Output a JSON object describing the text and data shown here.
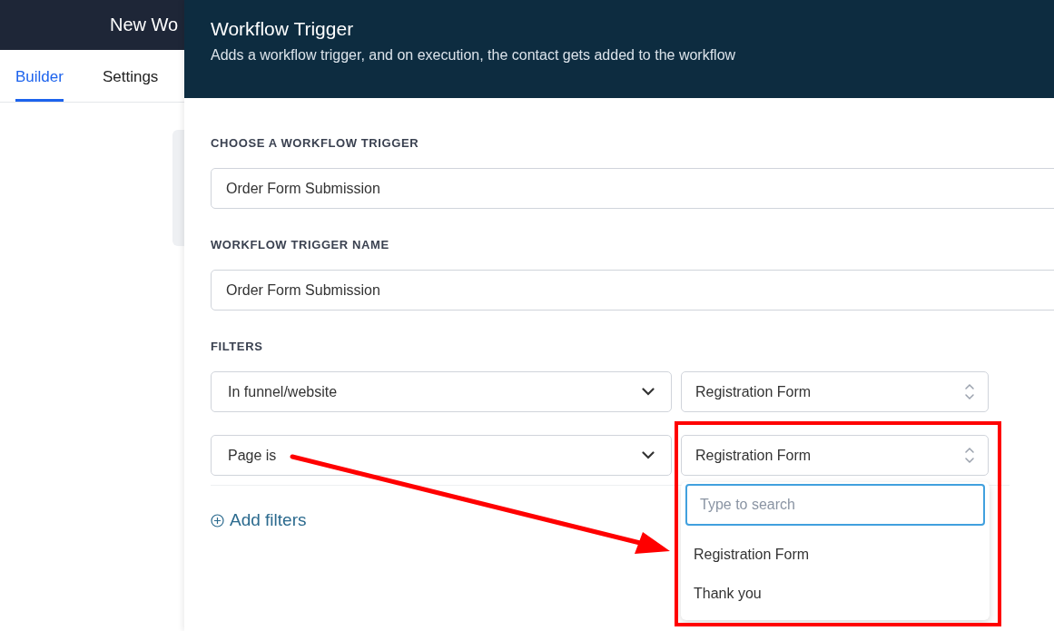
{
  "app_bar": {
    "title": "New Wo"
  },
  "tabs": [
    {
      "label": "Builder",
      "selected": true
    },
    {
      "label": "Settings",
      "selected": false
    }
  ],
  "drawer": {
    "title": "Workflow Trigger",
    "subtitle": "Adds a workflow trigger, and on execution, the contact gets added to the workflow",
    "trigger_label": "CHOOSE A WORKFLOW TRIGGER",
    "trigger_value": "Order Form Submission",
    "name_label": "WORKFLOW TRIGGER NAME",
    "name_value": "Order Form Submission",
    "filters_label": "FILTERS",
    "filters": [
      {
        "field": "In funnel/website",
        "value": "Registration Form"
      },
      {
        "field": "Page is",
        "value": "Registration Form",
        "search_placeholder": "Type to search",
        "options": [
          "Registration Form",
          "Thank you"
        ]
      }
    ],
    "add_filters": "Add filters"
  }
}
